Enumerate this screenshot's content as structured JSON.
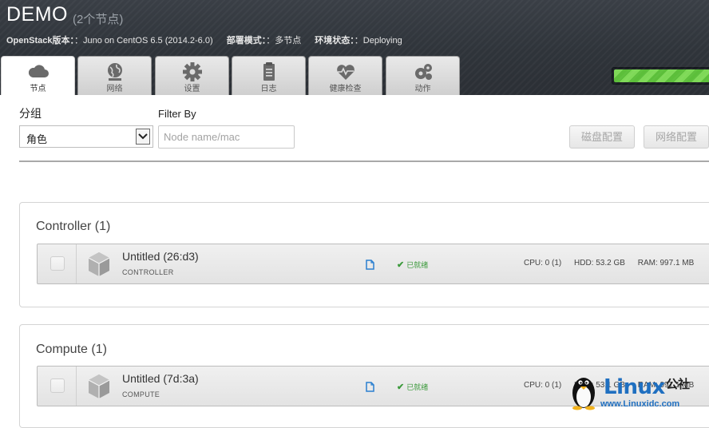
{
  "header": {
    "title": "DEMO",
    "subtitle": "(2个节点)",
    "info": [
      {
        "key": "OpenStack版本：",
        "value": "：Juno on CentOS 6.5 (2014.2-6.0)"
      },
      {
        "key": "部署模式：",
        "value": "：多节点"
      },
      {
        "key": "环境状态：",
        "value": "：Deploying"
      }
    ],
    "progress": 0.95
  },
  "tabs": [
    {
      "label": "节点",
      "icon": "cloud-icon",
      "active": true
    },
    {
      "label": "网络",
      "icon": "globe-network-icon",
      "active": false
    },
    {
      "label": "设置",
      "icon": "gear-icon",
      "active": false
    },
    {
      "label": "日志",
      "icon": "clipboard-icon",
      "active": false
    },
    {
      "label": "健康检查",
      "icon": "heart-pulse-icon",
      "active": false
    },
    {
      "label": "动作",
      "icon": "gears-icon",
      "active": false
    }
  ],
  "toolbar": {
    "group_label": "分组",
    "group_value": "角色",
    "filter_label": "Filter By",
    "filter_placeholder": "Node name/mac",
    "disk_button": "磁盘配置",
    "network_button": "网络配置"
  },
  "groups": [
    {
      "title": "Controller (1)",
      "nodes": [
        {
          "name": "Untitled (26:d3)",
          "role": "CONTROLLER",
          "status": "已就绪",
          "cpu": "CPU: 0 (1)",
          "hdd": "HDD: 53.2 GB",
          "ram": "RAM: 997.1 MB"
        }
      ]
    },
    {
      "title": "Compute (1)",
      "nodes": [
        {
          "name": "Untitled (7d:3a)",
          "role": "COMPUTE",
          "status": "已就绪",
          "cpu": "CPU: 0 (1)",
          "hdd": "HDD: 53.1 GB",
          "ram": "RAM: 997.1 MB"
        }
      ]
    }
  ],
  "watermark": {
    "brand": "Linux",
    "cn": "公社",
    "url": "www.Linuxidc.com"
  },
  "colors": {
    "header_bg": "#2f343a",
    "progress_green": "#6fcf4a",
    "status_green": "#3c9a3c",
    "file_icon_blue": "#2a7fd0"
  }
}
